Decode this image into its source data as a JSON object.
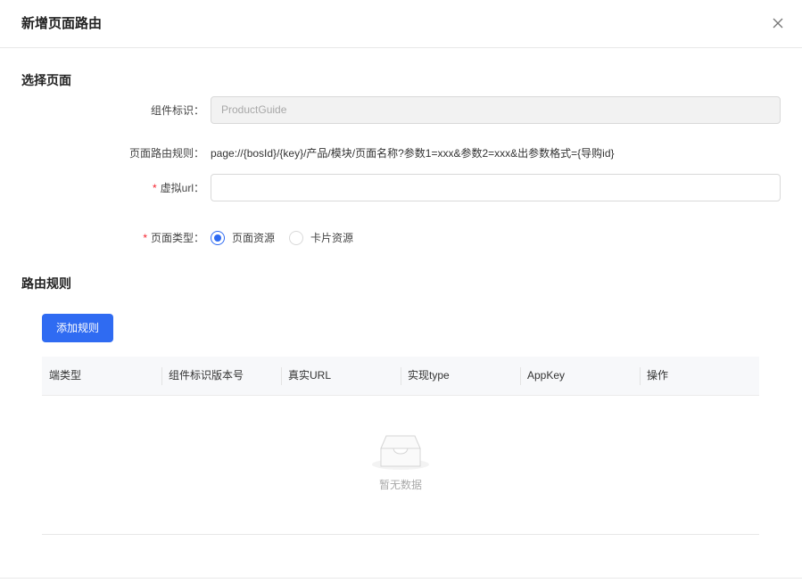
{
  "dialog": {
    "title": "新增页面路由",
    "close_icon": "close-icon"
  },
  "select_page": {
    "section_title": "选择页面",
    "component_id_label": "组件标识：",
    "component_id_value": "ProductGuide",
    "route_rule_label": "页面路由规则：",
    "route_rule_value": "page://{bosId}/{key}/产品/模块/页面名称?参数1=xxx&参数2=xxx&出参数格式={导购id}",
    "virtual_url_label": "虚拟url：",
    "virtual_url_value": "",
    "required_mark": "*",
    "page_type_label": "页面类型：",
    "page_type_options": [
      {
        "label": "页面资源",
        "checked": true
      },
      {
        "label": "卡片资源",
        "checked": false
      }
    ]
  },
  "route_rules": {
    "section_title": "路由规则",
    "add_button_label": "添加规则",
    "columns": [
      "端类型",
      "组件标识版本号",
      "真实URL",
      "实现type",
      "AppKey",
      "操作"
    ],
    "empty_text": "暂无数据",
    "empty_icon": "empty-inbox-icon"
  },
  "colors": {
    "primary": "#2f6bf2",
    "required": "#f5222d"
  }
}
